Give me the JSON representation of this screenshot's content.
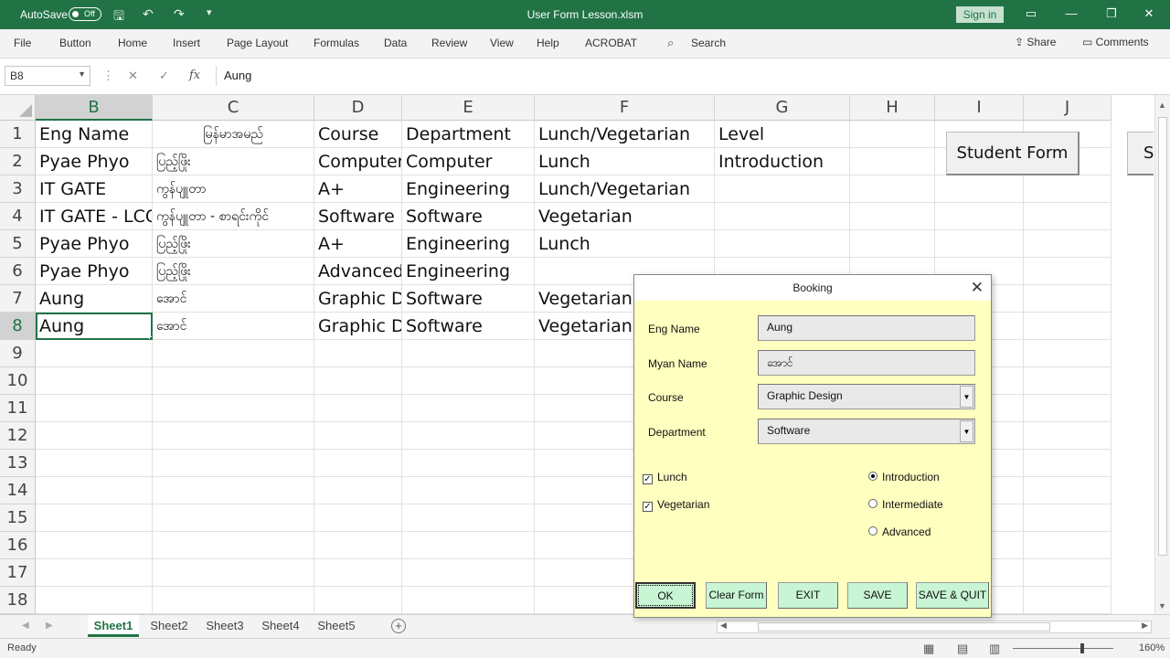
{
  "titlebar": {
    "autosave_label": "AutoSave",
    "autosave_state": "Off",
    "doc_title": "User Form Lesson.xlsm",
    "signin_label": "Sign in"
  },
  "ribbon": {
    "tabs": [
      "File",
      "Button",
      "Home",
      "Insert",
      "Page Layout",
      "Formulas",
      "Data",
      "Review",
      "View",
      "Help",
      "ACROBAT"
    ],
    "search_label": "Search",
    "share_label": "Share",
    "comments_label": "Comments"
  },
  "formula_bar": {
    "name_box": "B8",
    "fx_label": "fx",
    "value": "Aung"
  },
  "grid": {
    "columns": [
      "B",
      "C",
      "D",
      "E",
      "F",
      "G",
      "H",
      "I",
      "J"
    ],
    "selected_column": "B",
    "rows": [
      "1",
      "2",
      "3",
      "4",
      "5",
      "6",
      "7",
      "8",
      "9",
      "10",
      "11",
      "12",
      "13",
      "14",
      "15",
      "16",
      "17",
      "18"
    ],
    "selected_row": "8",
    "data": [
      [
        "Eng Name",
        "မြန်မာအမည်",
        "Course",
        "Department",
        "Lunch/Vegetarian",
        "Level"
      ],
      [
        "Pyae Phyo",
        "ပြည့်ဖြိုး",
        "Computer",
        "Computer",
        "Lunch",
        "Introduction"
      ],
      [
        "IT GATE",
        "ကွန်ပျူတာ",
        "A+",
        "Engineering",
        "Lunch/Vegetarian",
        ""
      ],
      [
        "IT GATE - LCCI",
        "ကွန်ပျူတာ - စာရင်းကိုင်",
        "Software E",
        "Software",
        "Vegetarian",
        ""
      ],
      [
        "Pyae Phyo",
        "ပြည့်ဖြိုး",
        "A+",
        "Engineering",
        "Lunch",
        ""
      ],
      [
        "Pyae Phyo",
        "ပြည့်ဖြိုး",
        "Advanced",
        "Engineering",
        "",
        ""
      ],
      [
        "Aung",
        "အောင်",
        "Graphic De",
        "Software",
        "Vegetarian",
        ""
      ],
      [
        "Aung",
        "အောင်",
        "Graphic De",
        "Software",
        "Vegetarian",
        ""
      ]
    ],
    "sheet_buttons": [
      "Student Form",
      "S"
    ]
  },
  "sheet_tabs": [
    "Sheet1",
    "Sheet2",
    "Sheet3",
    "Sheet4",
    "Sheet5"
  ],
  "active_sheet": "Sheet1",
  "statusbar": {
    "ready": "Ready",
    "zoom": "160%"
  },
  "userform": {
    "title": "Booking",
    "fields": {
      "eng_name_label": "Eng Name",
      "eng_name_value": "Aung",
      "myan_name_label": "Myan Name",
      "myan_name_value": "အောင်",
      "course_label": "Course",
      "course_value": "Graphic Design",
      "department_label": "Department",
      "department_value": "Software"
    },
    "checkboxes": [
      {
        "label": "Lunch",
        "checked": true
      },
      {
        "label": "Vegetarian",
        "checked": true
      }
    ],
    "radios": [
      {
        "label": "Introduction",
        "selected": true
      },
      {
        "label": "Intermediate",
        "selected": false
      },
      {
        "label": "Advanced",
        "selected": false
      }
    ],
    "buttons": {
      "ok": "OK",
      "clear": "Clear Form",
      "exit": "EXIT",
      "save": "SAVE",
      "save_quit": "SAVE & QUIT"
    }
  }
}
